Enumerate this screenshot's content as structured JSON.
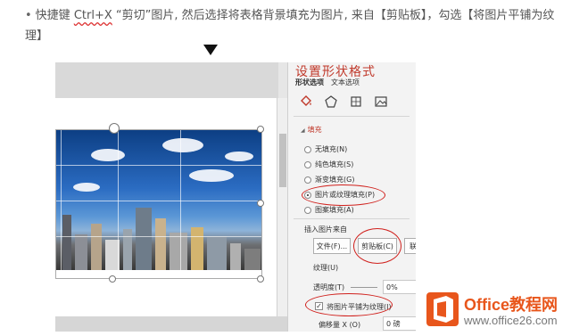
{
  "instruction": {
    "bullet": "•",
    "part1": "快捷键 ",
    "shortcut": "Ctrl+X",
    "part2": " “剪切”图片, 然后选择将表格背景填充为图片, 来自【剪贴板】，勾选【将图片平铺为纹理】"
  },
  "panel": {
    "title": "设置形状格式",
    "tabs": [
      "形状选项",
      "文本选项"
    ],
    "icons": [
      "fill-bucket-icon",
      "pentagon-icon",
      "size-properties-icon",
      "picture-icon"
    ],
    "section_fill": "填充",
    "fill_options": [
      {
        "label": "无填充(N)",
        "selected": false
      },
      {
        "label": "纯色填充(S)",
        "selected": false
      },
      {
        "label": "渐变填充(G)",
        "selected": false
      },
      {
        "label": "图片或纹理填充(P)",
        "selected": true
      },
      {
        "label": "图案填充(A)",
        "selected": false
      }
    ],
    "insert_from_label": "插入图片来自",
    "file_button": "文件(F)...",
    "clipboard_button": "剪贴板(C)",
    "online_button": "联",
    "texture_label": "纹理(U)",
    "transparency_label": "透明度(T)",
    "transparency_value": "0%",
    "tile_checkbox_label": "将图片平铺为纹理(I)",
    "tile_checked": true,
    "offset_x_label": "偏移量 X (O)",
    "offset_x_value": "0 磅"
  },
  "watermark": {
    "name": "Office教程网",
    "url": "www.office26.com",
    "color": "#e8561c"
  }
}
